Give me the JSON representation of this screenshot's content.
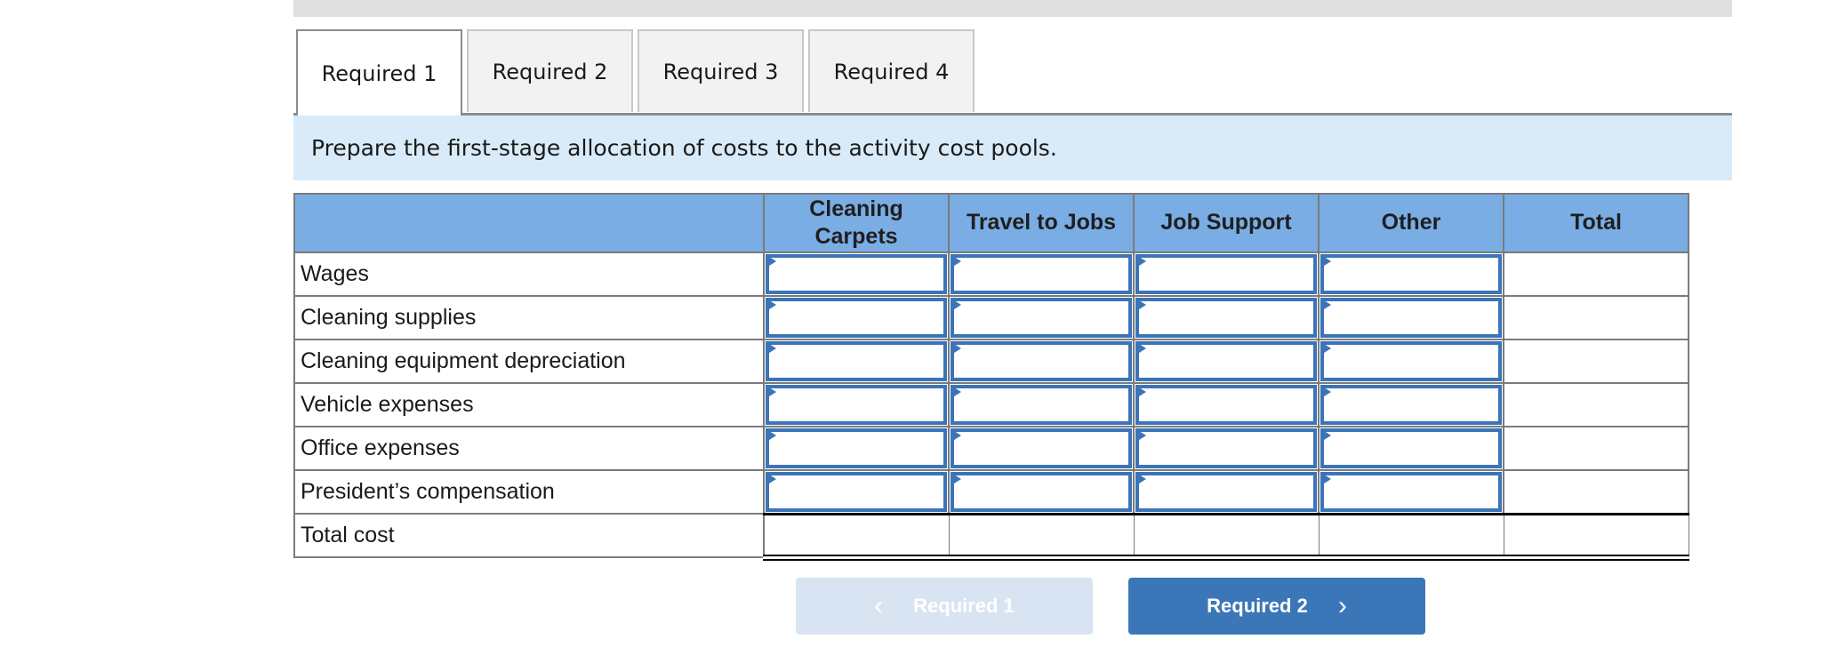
{
  "tabs": [
    {
      "label": "Required 1",
      "active": true
    },
    {
      "label": "Required 2",
      "active": false
    },
    {
      "label": "Required 3",
      "active": false
    },
    {
      "label": "Required 4",
      "active": false
    }
  ],
  "instruction": "Prepare the first-stage allocation of costs to the activity cost pools.",
  "table": {
    "columns": [
      "",
      "Cleaning Carpets",
      "Travel to Jobs",
      "Job Support",
      "Other",
      "Total"
    ],
    "column_lines": {
      "cleaning_carpets_1": "Cleaning",
      "cleaning_carpets_2": "Carpets"
    },
    "rows": [
      {
        "label": "Wages",
        "values": [
          "",
          "",
          "",
          ""
        ],
        "total": ""
      },
      {
        "label": "Cleaning supplies",
        "values": [
          "",
          "",
          "",
          ""
        ],
        "total": ""
      },
      {
        "label": "Cleaning equipment depreciation",
        "values": [
          "",
          "",
          "",
          ""
        ],
        "total": ""
      },
      {
        "label": "Vehicle expenses",
        "values": [
          "",
          "",
          "",
          ""
        ],
        "total": ""
      },
      {
        "label": "Office expenses",
        "values": [
          "",
          "",
          "",
          ""
        ],
        "total": ""
      },
      {
        "label": "President’s compensation",
        "values": [
          "",
          "",
          "",
          ""
        ],
        "total": ""
      }
    ],
    "total_row": {
      "label": "Total cost",
      "values": [
        "",
        "",
        "",
        "",
        ""
      ]
    }
  },
  "navigation": {
    "prev": {
      "label": "Required 1",
      "icon": "chevron-left-icon",
      "glyph": "‹",
      "disabled": true
    },
    "next": {
      "label": "Required 2",
      "icon": "chevron-right-icon",
      "glyph": "›",
      "disabled": false
    }
  },
  "colors": {
    "header_bg": "#7aade4",
    "instruction_bg": "#d9ebf8",
    "input_border": "#3b74b8",
    "next_button": "#3b76b9",
    "prev_button_disabled": "#d8e4f1"
  }
}
